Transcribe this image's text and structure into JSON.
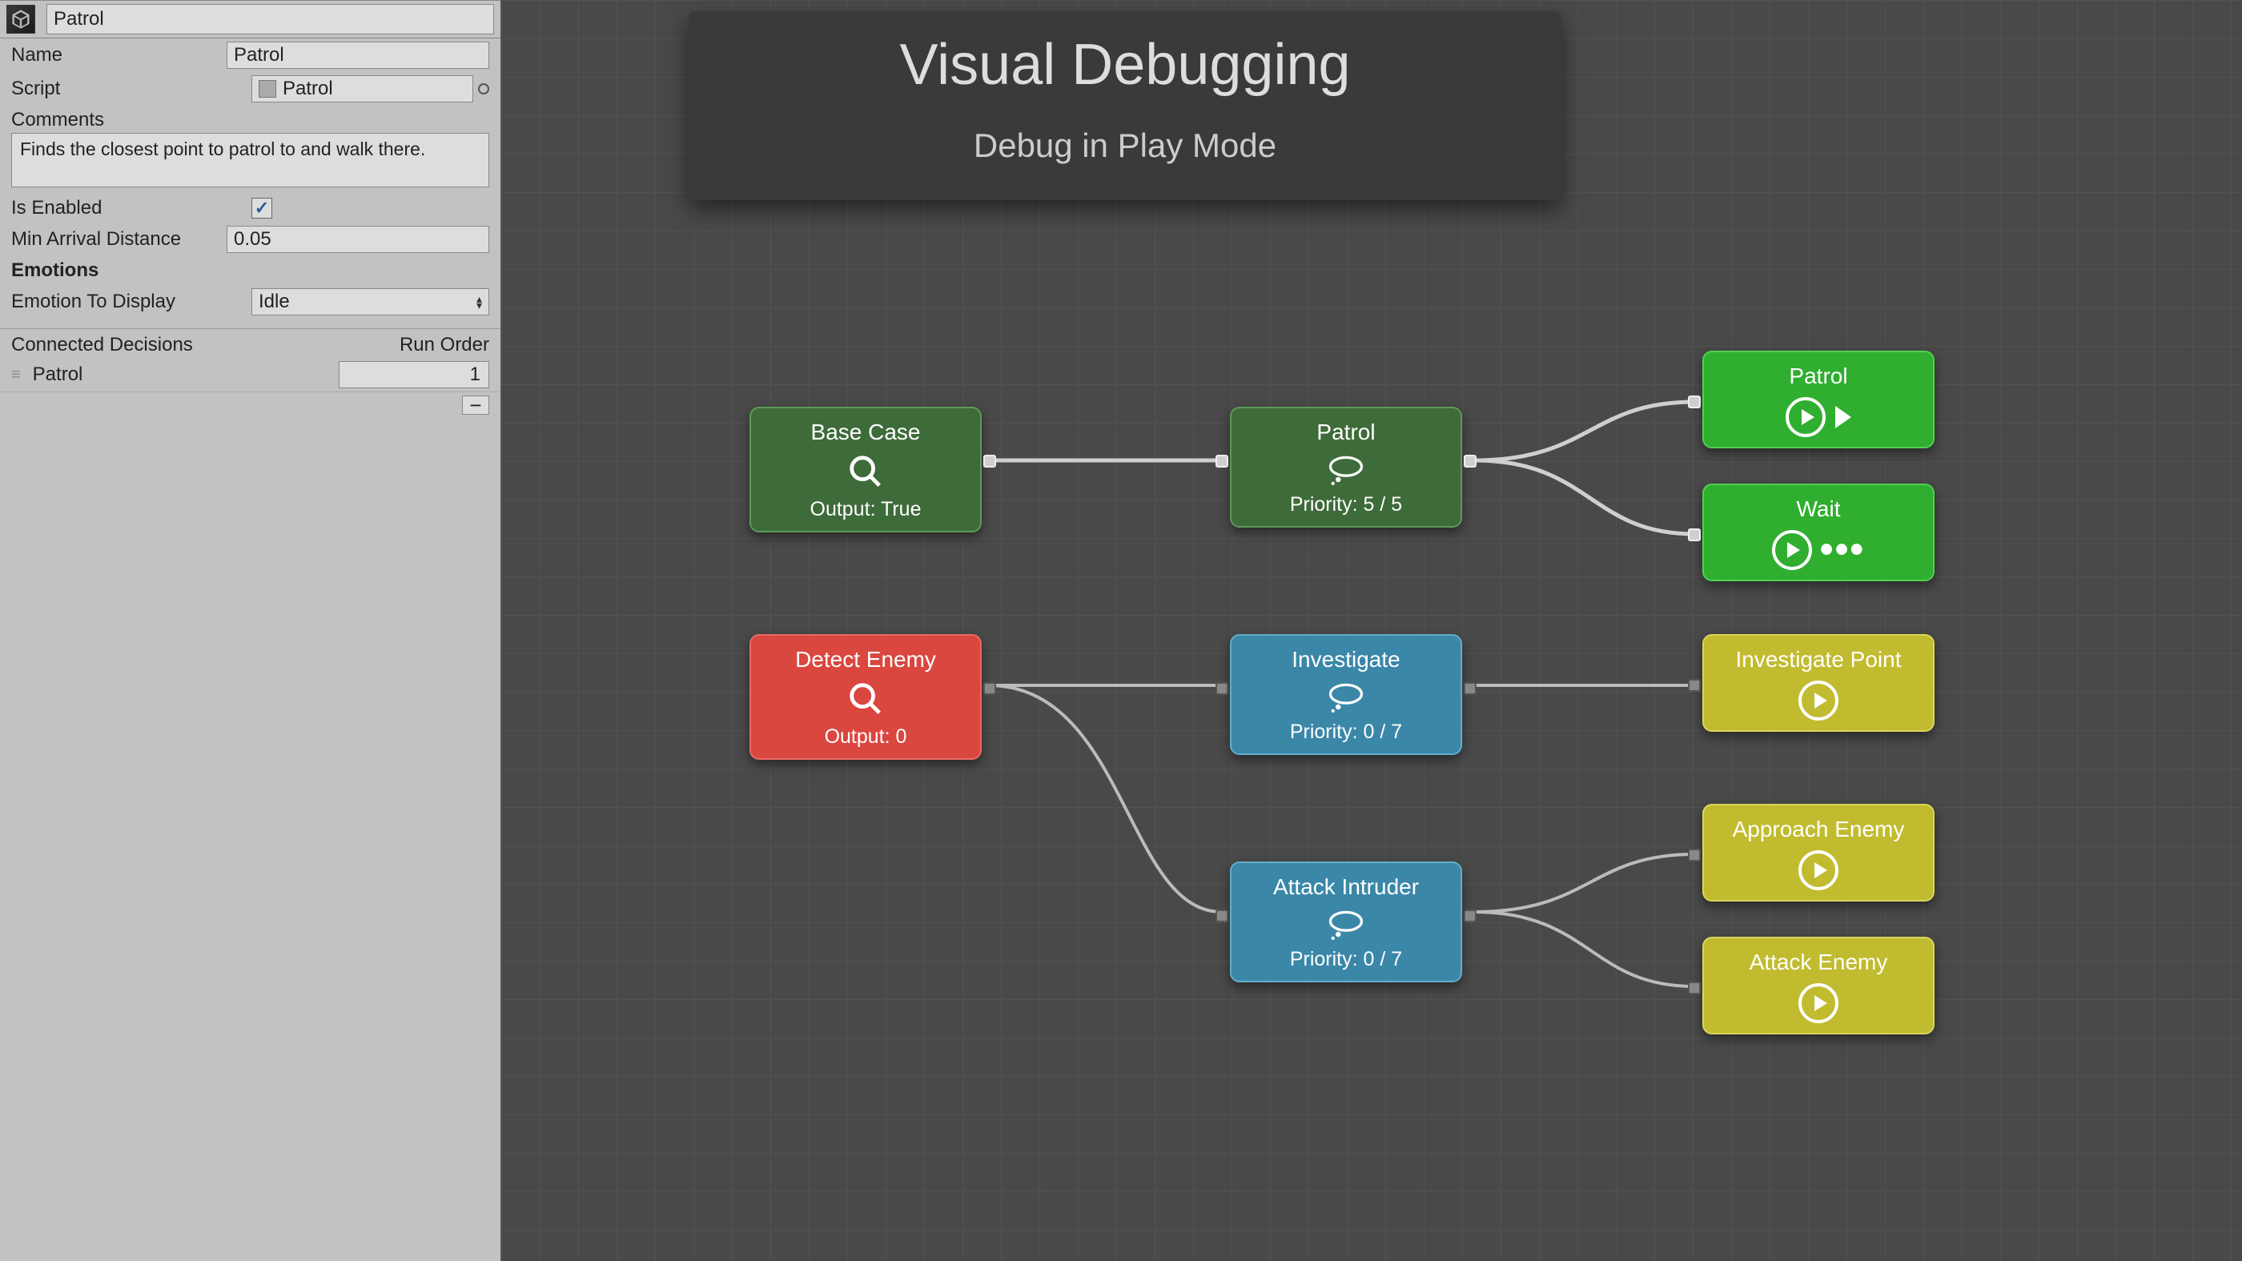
{
  "inspector": {
    "header_name": "Patrol",
    "name_label": "Name",
    "name_value": "Patrol",
    "script_label": "Script",
    "script_value": "Patrol",
    "comments_label": "Comments",
    "comments_value": "Finds the closest point to patrol to and walk there.",
    "is_enabled_label": "Is Enabled",
    "is_enabled_value": true,
    "min_arrival_label": "Min Arrival Distance",
    "min_arrival_value": "0.05",
    "emotions_section": "Emotions",
    "emotion_label": "Emotion To Display",
    "emotion_value": "Idle",
    "connected_label": "Connected Decisions",
    "run_order_label": "Run Order",
    "connected_items": [
      {
        "name": "Patrol",
        "order": "1"
      }
    ],
    "minus_label": "−"
  },
  "title": {
    "main": "Visual Debugging",
    "sub": "Debug in Play Mode"
  },
  "nodes": {
    "base_case": {
      "title": "Base Case",
      "sub": "Output: True"
    },
    "patrol_mid": {
      "title": "Patrol",
      "sub": "Priority: 5 / 5"
    },
    "patrol_act": {
      "title": "Patrol"
    },
    "wait": {
      "title": "Wait"
    },
    "detect": {
      "title": "Detect Enemy",
      "sub": "Output: 0"
    },
    "investigate": {
      "title": "Investigate",
      "sub": "Priority: 0 / 7"
    },
    "investigate_point": {
      "title": "Investigate Point"
    },
    "attack_intruder": {
      "title": "Attack Intruder",
      "sub": "Priority: 0 / 7"
    },
    "approach_enemy": {
      "title": "Approach Enemy"
    },
    "attack_enemy": {
      "title": "Attack Enemy"
    }
  }
}
